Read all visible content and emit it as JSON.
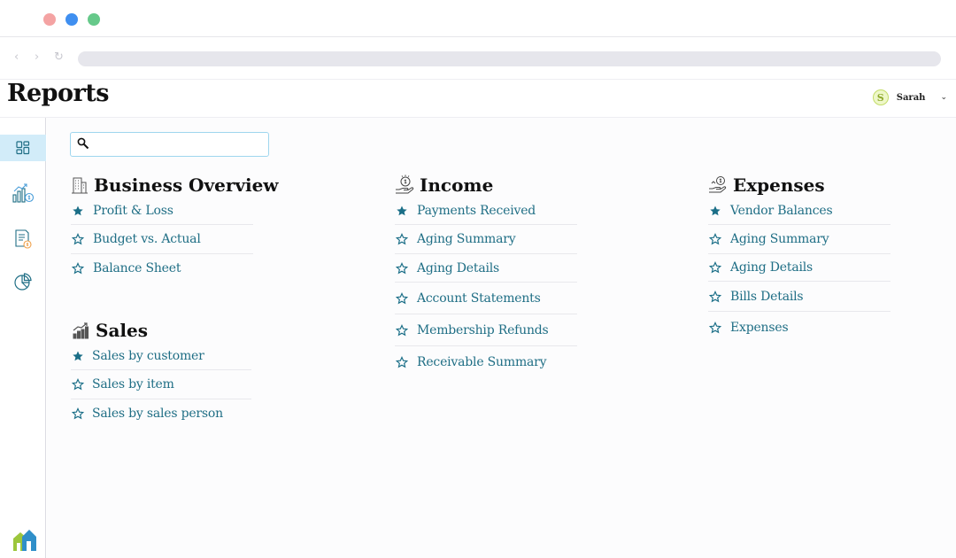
{
  "page": {
    "title": "Reports"
  },
  "user": {
    "initial": "S",
    "name": "Sarah"
  },
  "search": {
    "value": "",
    "placeholder": ""
  },
  "sidebar": {
    "items": [
      {
        "name": "dashboard",
        "icon": "grid-icon",
        "active": true
      },
      {
        "name": "revenue",
        "icon": "chart-dollar-icon",
        "active": false
      },
      {
        "name": "documents",
        "icon": "invoice-icon",
        "active": false
      },
      {
        "name": "analytics",
        "icon": "pie-chart-icon",
        "active": false
      }
    ],
    "logo_icon": "house-logo-icon"
  },
  "sections": {
    "business_overview": {
      "title": "Business Overview",
      "icon": "building-icon",
      "items": [
        {
          "label": "Profit & Loss",
          "starred": true
        },
        {
          "label": "Budget vs. Actual",
          "starred": false
        },
        {
          "label": "Balance Sheet",
          "starred": false
        }
      ]
    },
    "sales": {
      "title": "Sales",
      "icon": "sales-growth-icon",
      "items": [
        {
          "label": "Sales by customer",
          "starred": true
        },
        {
          "label": "Sales by item",
          "starred": false
        },
        {
          "label": "Sales by sales person",
          "starred": false
        }
      ]
    },
    "income": {
      "title": "Income",
      "icon": "hand-coin-icon",
      "items": [
        {
          "label": "Payments Received",
          "starred": true
        },
        {
          "label": "Aging Summary",
          "starred": false
        },
        {
          "label": "Aging Details",
          "starred": false
        },
        {
          "label": "Account Statements",
          "starred": false
        },
        {
          "label": "Membership Refunds",
          "starred": false
        },
        {
          "label": "Receivable Summary",
          "starred": false
        }
      ]
    },
    "expenses": {
      "title": "Expenses",
      "icon": "hand-payment-icon",
      "items": [
        {
          "label": "Vendor Balances",
          "starred": true
        },
        {
          "label": "Aging Summary",
          "starred": false
        },
        {
          "label": "Aging Details",
          "starred": false
        },
        {
          "label": "Bills Details",
          "starred": false
        },
        {
          "label": "Expenses",
          "starred": false
        }
      ]
    }
  },
  "colors": {
    "accent": "#1f6e85",
    "star": "#1a6e87",
    "active_sidebar": "#d2ecf9"
  }
}
